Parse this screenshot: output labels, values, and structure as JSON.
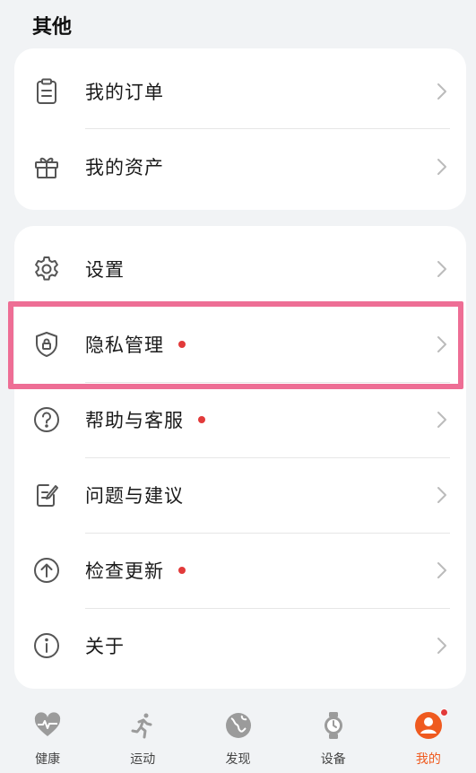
{
  "section_title": "其他",
  "group1": [
    {
      "label": "我的订单",
      "icon": "clipboard-icon"
    },
    {
      "label": "我的资产",
      "icon": "gift-icon"
    }
  ],
  "group2": [
    {
      "label": "设置",
      "icon": "gear-icon",
      "dot": false
    },
    {
      "label": "隐私管理",
      "icon": "shield-lock-icon",
      "dot": true
    },
    {
      "label": "帮助与客服",
      "icon": "question-icon",
      "dot": true
    },
    {
      "label": "问题与建议",
      "icon": "edit-note-icon",
      "dot": false
    },
    {
      "label": "检查更新",
      "icon": "arrow-up-circle-icon",
      "dot": true
    },
    {
      "label": "关于",
      "icon": "info-icon",
      "dot": false
    }
  ],
  "tabs": [
    {
      "label": "健康",
      "icon": "heart-pulse-icon",
      "active": false
    },
    {
      "label": "运动",
      "icon": "runner-icon",
      "active": false
    },
    {
      "label": "发现",
      "icon": "globe-icon",
      "active": false
    },
    {
      "label": "设备",
      "icon": "watch-icon",
      "active": false
    },
    {
      "label": "我的",
      "icon": "user-avatar-icon",
      "active": true
    }
  ],
  "colors": {
    "background": "#f1f3f5",
    "card": "#ffffff",
    "badge_dot": "#e23a3a",
    "highlight": "#ee6e95",
    "active_tab": "#ef5a1f"
  }
}
